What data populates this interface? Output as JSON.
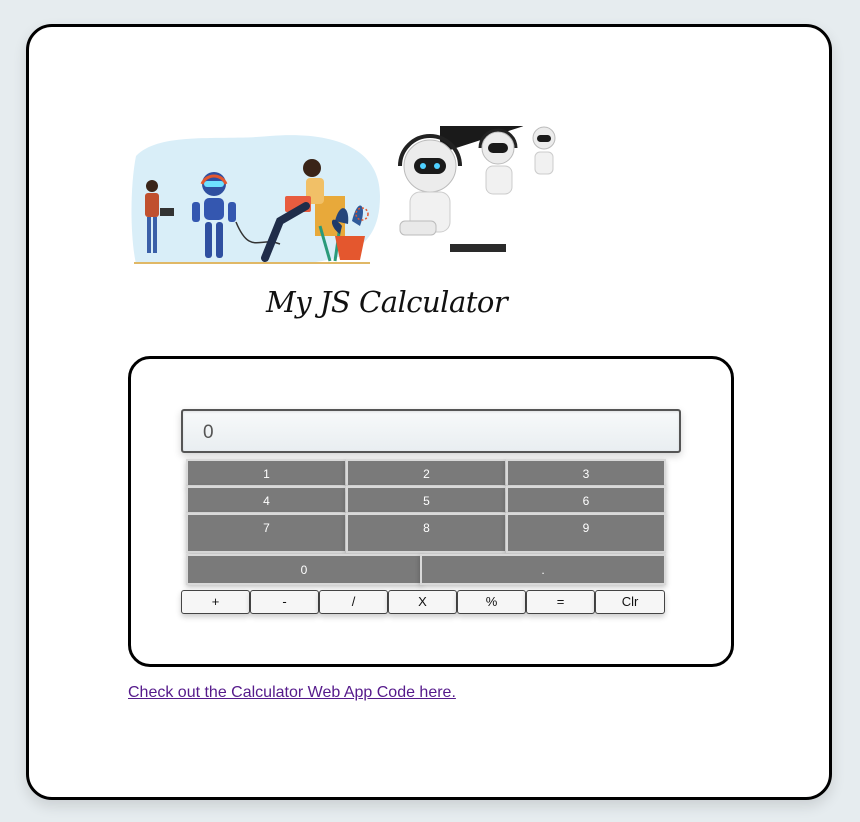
{
  "title": "My JS Calculator",
  "display": {
    "value": "0"
  },
  "keys": {
    "k1": "1",
    "k2": "2",
    "k3": "3",
    "k4": "4",
    "k5": "5",
    "k6": "6",
    "k7": "7",
    "k8": "8",
    "k9": "9",
    "k0": "0",
    "kdot": "."
  },
  "operators": {
    "plus": "+",
    "minus": "-",
    "divide": "/",
    "multiply": "X",
    "percent": "%",
    "equals": "=",
    "clear": "Clr"
  },
  "link": {
    "text": "Check out the Calculator Web App Code here."
  },
  "colors": {
    "key_bg": "#7a7a7a",
    "page_bg": "#e6ecef",
    "link": "#551a8b"
  }
}
